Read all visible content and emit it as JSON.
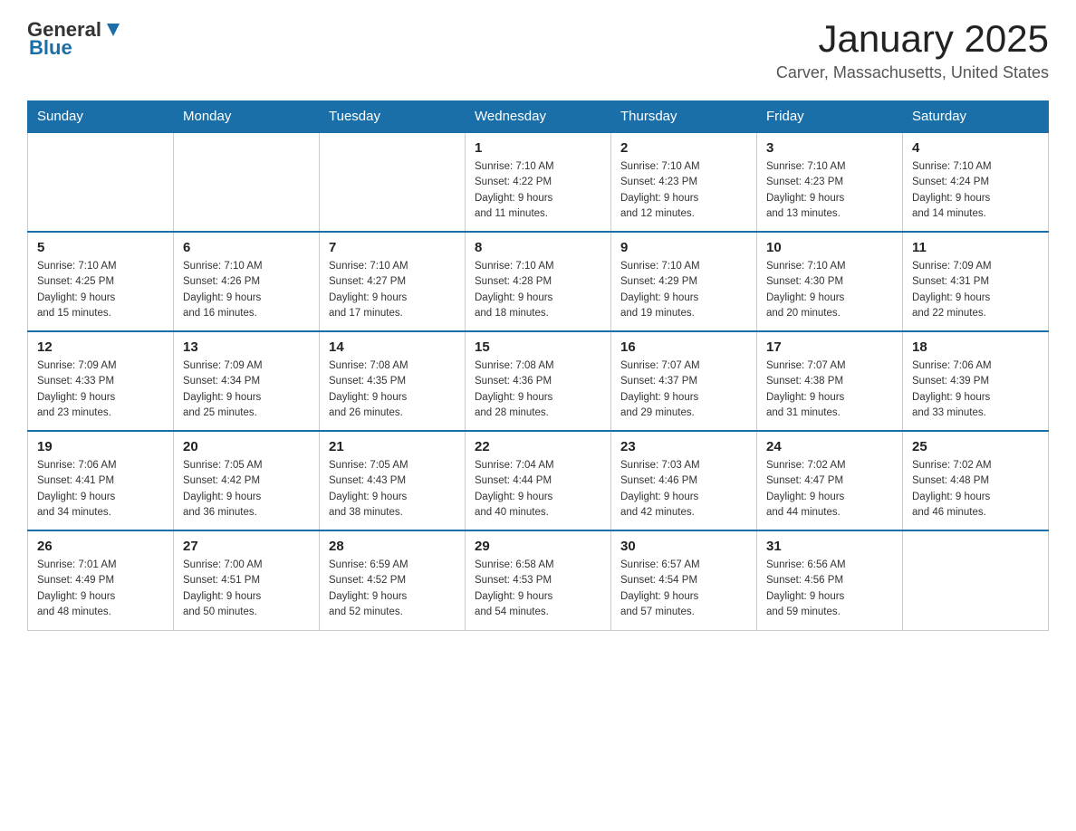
{
  "logo": {
    "general": "General",
    "blue": "Blue"
  },
  "title": "January 2025",
  "subtitle": "Carver, Massachusetts, United States",
  "weekdays": [
    "Sunday",
    "Monday",
    "Tuesday",
    "Wednesday",
    "Thursday",
    "Friday",
    "Saturday"
  ],
  "weeks": [
    [
      {
        "day": "",
        "info": ""
      },
      {
        "day": "",
        "info": ""
      },
      {
        "day": "",
        "info": ""
      },
      {
        "day": "1",
        "info": "Sunrise: 7:10 AM\nSunset: 4:22 PM\nDaylight: 9 hours\nand 11 minutes."
      },
      {
        "day": "2",
        "info": "Sunrise: 7:10 AM\nSunset: 4:23 PM\nDaylight: 9 hours\nand 12 minutes."
      },
      {
        "day": "3",
        "info": "Sunrise: 7:10 AM\nSunset: 4:23 PM\nDaylight: 9 hours\nand 13 minutes."
      },
      {
        "day": "4",
        "info": "Sunrise: 7:10 AM\nSunset: 4:24 PM\nDaylight: 9 hours\nand 14 minutes."
      }
    ],
    [
      {
        "day": "5",
        "info": "Sunrise: 7:10 AM\nSunset: 4:25 PM\nDaylight: 9 hours\nand 15 minutes."
      },
      {
        "day": "6",
        "info": "Sunrise: 7:10 AM\nSunset: 4:26 PM\nDaylight: 9 hours\nand 16 minutes."
      },
      {
        "day": "7",
        "info": "Sunrise: 7:10 AM\nSunset: 4:27 PM\nDaylight: 9 hours\nand 17 minutes."
      },
      {
        "day": "8",
        "info": "Sunrise: 7:10 AM\nSunset: 4:28 PM\nDaylight: 9 hours\nand 18 minutes."
      },
      {
        "day": "9",
        "info": "Sunrise: 7:10 AM\nSunset: 4:29 PM\nDaylight: 9 hours\nand 19 minutes."
      },
      {
        "day": "10",
        "info": "Sunrise: 7:10 AM\nSunset: 4:30 PM\nDaylight: 9 hours\nand 20 minutes."
      },
      {
        "day": "11",
        "info": "Sunrise: 7:09 AM\nSunset: 4:31 PM\nDaylight: 9 hours\nand 22 minutes."
      }
    ],
    [
      {
        "day": "12",
        "info": "Sunrise: 7:09 AM\nSunset: 4:33 PM\nDaylight: 9 hours\nand 23 minutes."
      },
      {
        "day": "13",
        "info": "Sunrise: 7:09 AM\nSunset: 4:34 PM\nDaylight: 9 hours\nand 25 minutes."
      },
      {
        "day": "14",
        "info": "Sunrise: 7:08 AM\nSunset: 4:35 PM\nDaylight: 9 hours\nand 26 minutes."
      },
      {
        "day": "15",
        "info": "Sunrise: 7:08 AM\nSunset: 4:36 PM\nDaylight: 9 hours\nand 28 minutes."
      },
      {
        "day": "16",
        "info": "Sunrise: 7:07 AM\nSunset: 4:37 PM\nDaylight: 9 hours\nand 29 minutes."
      },
      {
        "day": "17",
        "info": "Sunrise: 7:07 AM\nSunset: 4:38 PM\nDaylight: 9 hours\nand 31 minutes."
      },
      {
        "day": "18",
        "info": "Sunrise: 7:06 AM\nSunset: 4:39 PM\nDaylight: 9 hours\nand 33 minutes."
      }
    ],
    [
      {
        "day": "19",
        "info": "Sunrise: 7:06 AM\nSunset: 4:41 PM\nDaylight: 9 hours\nand 34 minutes."
      },
      {
        "day": "20",
        "info": "Sunrise: 7:05 AM\nSunset: 4:42 PM\nDaylight: 9 hours\nand 36 minutes."
      },
      {
        "day": "21",
        "info": "Sunrise: 7:05 AM\nSunset: 4:43 PM\nDaylight: 9 hours\nand 38 minutes."
      },
      {
        "day": "22",
        "info": "Sunrise: 7:04 AM\nSunset: 4:44 PM\nDaylight: 9 hours\nand 40 minutes."
      },
      {
        "day": "23",
        "info": "Sunrise: 7:03 AM\nSunset: 4:46 PM\nDaylight: 9 hours\nand 42 minutes."
      },
      {
        "day": "24",
        "info": "Sunrise: 7:02 AM\nSunset: 4:47 PM\nDaylight: 9 hours\nand 44 minutes."
      },
      {
        "day": "25",
        "info": "Sunrise: 7:02 AM\nSunset: 4:48 PM\nDaylight: 9 hours\nand 46 minutes."
      }
    ],
    [
      {
        "day": "26",
        "info": "Sunrise: 7:01 AM\nSunset: 4:49 PM\nDaylight: 9 hours\nand 48 minutes."
      },
      {
        "day": "27",
        "info": "Sunrise: 7:00 AM\nSunset: 4:51 PM\nDaylight: 9 hours\nand 50 minutes."
      },
      {
        "day": "28",
        "info": "Sunrise: 6:59 AM\nSunset: 4:52 PM\nDaylight: 9 hours\nand 52 minutes."
      },
      {
        "day": "29",
        "info": "Sunrise: 6:58 AM\nSunset: 4:53 PM\nDaylight: 9 hours\nand 54 minutes."
      },
      {
        "day": "30",
        "info": "Sunrise: 6:57 AM\nSunset: 4:54 PM\nDaylight: 9 hours\nand 57 minutes."
      },
      {
        "day": "31",
        "info": "Sunrise: 6:56 AM\nSunset: 4:56 PM\nDaylight: 9 hours\nand 59 minutes."
      },
      {
        "day": "",
        "info": ""
      }
    ]
  ]
}
